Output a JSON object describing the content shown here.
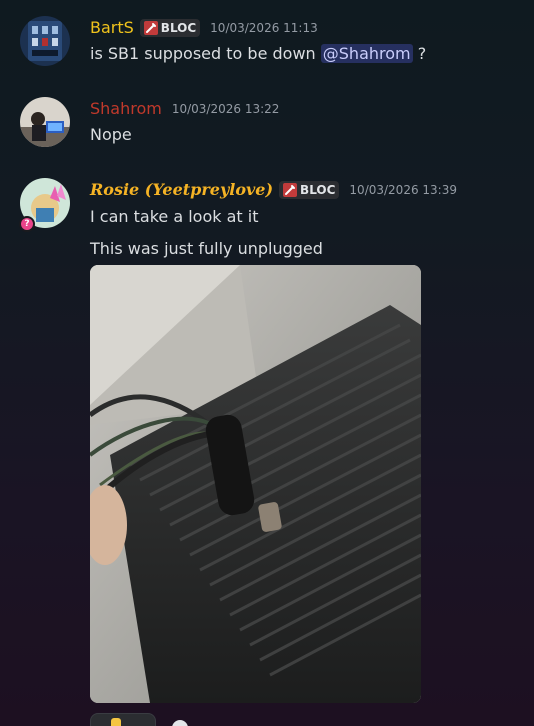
{
  "messages": [
    {
      "username": "BartS",
      "username_color": "#f0c31c",
      "tag": "BLOC",
      "timestamp": "10/03/2026 11:13",
      "lines": [
        "is SB1 supposed to be down"
      ],
      "mention": "@Shahrom",
      "trailing": "?"
    },
    {
      "username": "Shahrom",
      "username_color": "#c0392b",
      "timestamp": "10/03/2026 13:22",
      "lines": [
        "Nope"
      ]
    },
    {
      "username": "Rosie (Yeetpreylove)",
      "username_color": "#f5b325",
      "tag": "BLOC",
      "timestamp": "10/03/2026 13:39",
      "lines": [
        "I can take a look at it",
        "This was just fully unplugged"
      ],
      "attachment": "photo-of-unplugged-power-cable"
    }
  ],
  "colors": {
    "tag_bg": "#2b2d31",
    "mention_bg": "#3c4270",
    "timestamp": "#949ba4"
  }
}
